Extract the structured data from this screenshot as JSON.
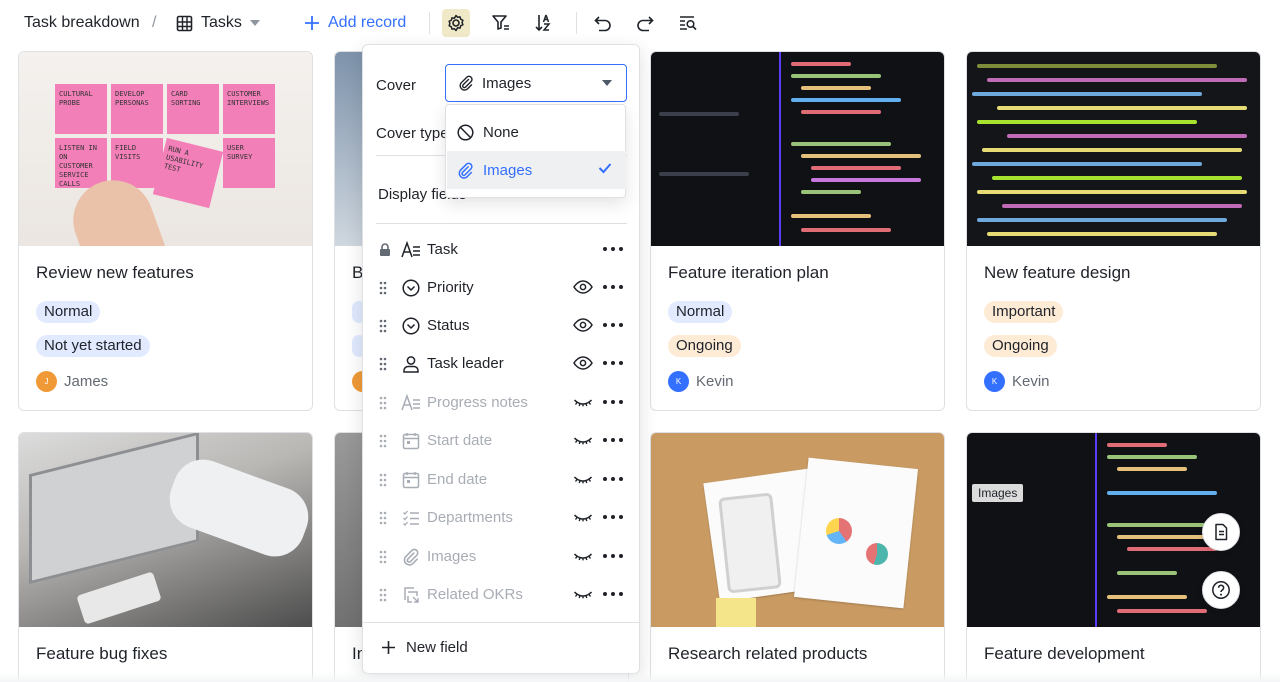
{
  "toolbar": {
    "title": "Task breakdown",
    "separator": "/",
    "view_name": "Tasks",
    "add_record": "Add record"
  },
  "cards_row1": [
    {
      "title": "Review new features",
      "tag1": "Normal",
      "tag2": "Not yet started",
      "person": "James",
      "initial": "J",
      "avatar_color": "#f09a37"
    },
    {
      "title": "B",
      "initial": ""
    },
    {
      "title": "Feature iteration plan",
      "tag1": "Normal",
      "tag2": "Ongoing",
      "person": "Kevin",
      "initial": "K",
      "avatar_color": "#3370ff"
    },
    {
      "title": "New feature design",
      "tag1": "Important",
      "tag2": "Ongoing",
      "person": "Kevin",
      "initial": "K",
      "avatar_color": "#3370ff"
    }
  ],
  "cards_row2": [
    {
      "title": "Feature bug fixes"
    },
    {
      "title": "In"
    },
    {
      "title": "Research related products"
    },
    {
      "title": "Feature development",
      "image_tag": "Images"
    }
  ],
  "panel": {
    "cover_label": "Cover",
    "cover_value": "Images",
    "cover_type_label": "Cover type",
    "display_fields_label": "Display fields",
    "fields": [
      {
        "name": "Task",
        "locked": true,
        "visible": true
      },
      {
        "name": "Priority",
        "visible": true
      },
      {
        "name": "Status",
        "visible": true
      },
      {
        "name": "Task leader",
        "visible": true
      },
      {
        "name": "Progress notes",
        "visible": false
      },
      {
        "name": "Start date",
        "visible": false
      },
      {
        "name": "End date",
        "visible": false
      },
      {
        "name": "Departments",
        "visible": false
      },
      {
        "name": "Images",
        "visible": false
      },
      {
        "name": "Related OKRs",
        "visible": false
      }
    ],
    "new_field": "New field"
  },
  "dropdown": {
    "options": [
      {
        "label": "None",
        "selected": false
      },
      {
        "label": "Images",
        "selected": true
      }
    ]
  },
  "colors": {
    "accent": "#3370ff",
    "active_toolbar_bg": "#f0e9c8"
  }
}
